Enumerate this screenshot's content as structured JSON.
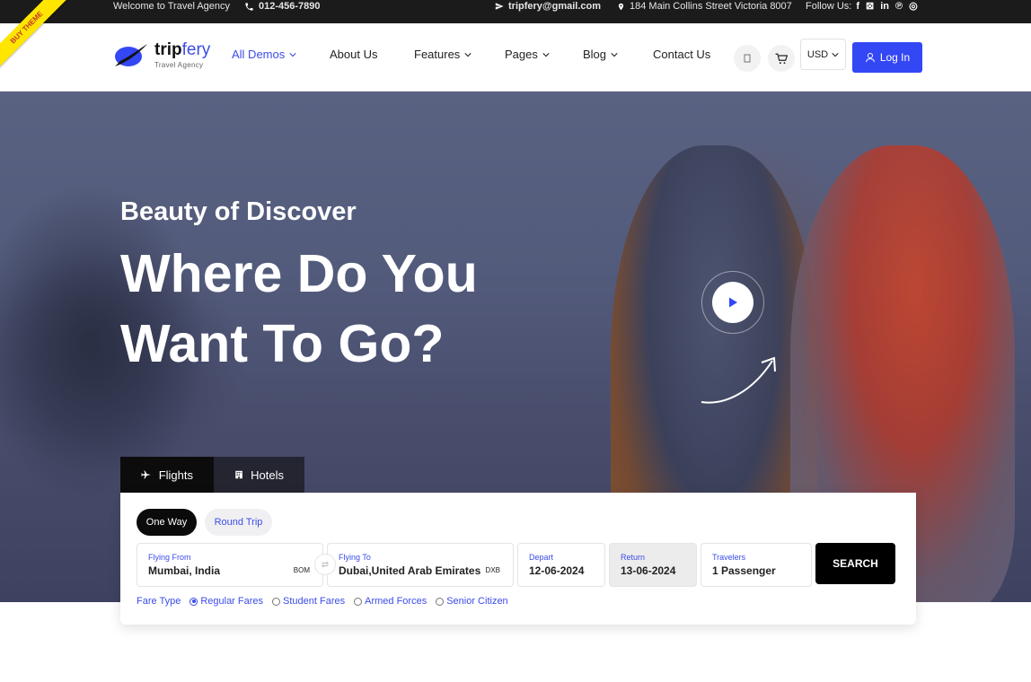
{
  "topbar": {
    "welcome": "Welcome to Travel Agency",
    "phone": "012-456-7890",
    "email": "tripfery@gmail.com",
    "address": "184 Main Collins Street Victoria 8007",
    "follow": "Follow Us:",
    "social": [
      "f",
      "X",
      "in",
      "p",
      "ig"
    ]
  },
  "ribbon": "BUY THEME",
  "brand": {
    "name_a": "trip",
    "name_b": "fery",
    "tagline": "Travel Agency",
    "accent": "#3b4ce8"
  },
  "nav": {
    "items": [
      {
        "label": "All Demos",
        "dropdown": true,
        "active": true
      },
      {
        "label": "About Us",
        "dropdown": false
      },
      {
        "label": "Features",
        "dropdown": true
      },
      {
        "label": "Pages",
        "dropdown": true
      },
      {
        "label": "Blog",
        "dropdown": true
      },
      {
        "label": "Contact Us",
        "dropdown": false
      }
    ],
    "currency": "USD",
    "login": "Log In"
  },
  "hero": {
    "eyebrow": "Beauty of Discover",
    "headline_1": "Where Do You",
    "headline_2": "Want To Go?"
  },
  "search": {
    "tabs": [
      "Flights",
      "Hotels"
    ],
    "trip_types": [
      "One Way",
      "Round Trip"
    ],
    "from": {
      "label": "Flying From",
      "value": "Mumbai, India",
      "code": "BOM"
    },
    "to": {
      "label": "Flying To",
      "value": "Dubai,United Arab Emirates",
      "code": "DXB"
    },
    "depart": {
      "label": "Depart",
      "value": "12-06-2024"
    },
    "return": {
      "label": "Return",
      "value": "13-06-2024"
    },
    "travelers": {
      "label": "Travelers",
      "value": "1 Passenger"
    },
    "button": "SEARCH",
    "fare_type_label": "Fare Type",
    "fares": [
      "Regular Fares",
      "Student Fares",
      "Armed Forces",
      "Senior Citizen"
    ],
    "selected_fare": "Regular Fares"
  }
}
